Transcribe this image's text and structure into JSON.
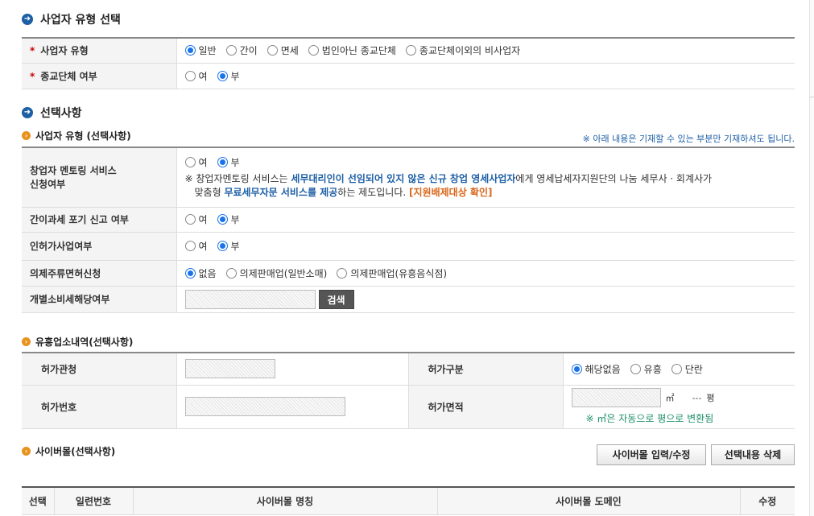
{
  "section1": {
    "title": "사업자 유형 선택",
    "rows": [
      {
        "label": "사업자 유형",
        "options": [
          "일반",
          "간이",
          "면세",
          "법인아닌 종교단체",
          "종교단체이외의 비사업자"
        ],
        "selected": 0
      },
      {
        "label": "종교단체 여부",
        "options": [
          "여",
          "부"
        ],
        "selected": 1
      }
    ]
  },
  "section2": {
    "title": "선택사항",
    "sub_title": "사업자 유형 (선택사항)",
    "note": "※ 아래 내용은 기재할 수 있는 부분만 기재하셔도 됩니다.",
    "mentoring": {
      "label_line1": "창업자 멘토링 서비스",
      "label_line2": "신청여부",
      "options": [
        "여",
        "부"
      ],
      "selected": 1,
      "notice_prefix": "※ 창업자멘토링 서비스는 ",
      "notice_bold1": "세무대리인이 선임되어 있지 않은 신규 창업 영세사업자",
      "notice_mid": "에게 영세납세자지원단의 나눔 세무사 · 회계사가",
      "notice_line2_pre": "맞춤형 ",
      "notice_bold2": "무료세무자문 서비스를 제공",
      "notice_line2_mid": "하는 제도입니다. ",
      "notice_link": "[지원배제대상 확인]"
    },
    "simple_tax": {
      "label": "간이과세 포기 신고 여부",
      "options": [
        "여",
        "부"
      ],
      "selected": 1
    },
    "license_biz": {
      "label": "인허가사업여부",
      "options": [
        "여",
        "부"
      ],
      "selected": 1
    },
    "liquor": {
      "label": "의제주류면허신청",
      "options": [
        "없음",
        "의제판매업(일반소매)",
        "의제판매업(유흥음식점)"
      ],
      "selected": 0
    },
    "excise": {
      "label": "개별소비세해당여부",
      "search_button": "검색"
    }
  },
  "section3": {
    "title": "유흥업소내역(선택사항)",
    "permit_office_label": "허가관청",
    "permit_type_label": "허가구분",
    "permit_type_options": [
      "해당없음",
      "유흥",
      "단란"
    ],
    "permit_type_selected": 0,
    "permit_no_label": "허가번호",
    "permit_area_label": "허가면적",
    "area_unit": "㎡",
    "pyeong_value": "---",
    "pyeong_unit": "평",
    "area_note": "※ ㎡은 자동으로 평으로 변환됨"
  },
  "section4": {
    "title": "사이버몰(선택사항)",
    "input_button": "사이버몰 입력/수정",
    "delete_button": "선택내용 삭제",
    "columns": [
      "선택",
      "일련번호",
      "사이버몰 명칭",
      "사이버몰 도메인",
      "수정"
    ]
  }
}
